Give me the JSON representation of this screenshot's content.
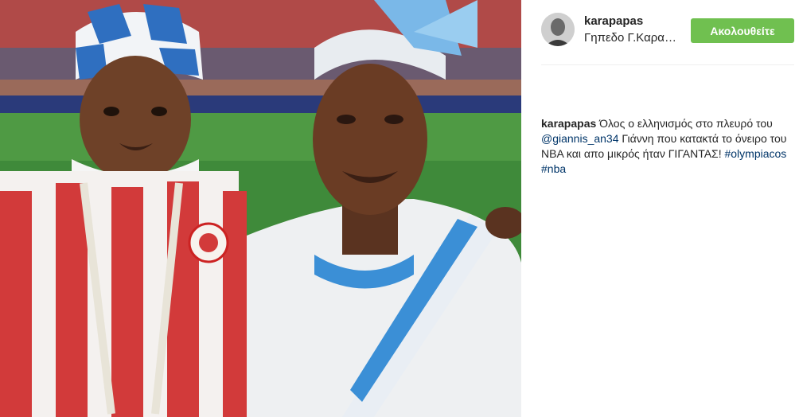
{
  "post": {
    "username": "karapapas",
    "location": "Γηπεδο Γ.Καραϊσκάκης",
    "follow_label": "Ακολουθείτε"
  },
  "caption": {
    "username": "karapapas",
    "text_1": " Όλος ο ελληνισμός στο πλευρό του ",
    "mention": "@giannis_an34",
    "text_2": " Γιάννη που κατακτά το όνειρο του NBA και απο μικρός ήταν ΓΙΓΑΝΤΑΣ! ",
    "hashtag_1": "#olympiacos",
    "space": " ",
    "hashtag_2": "#nba"
  },
  "colors": {
    "follow_button": "#70c050",
    "link": "#003569",
    "jersey_red": "#d23a3a",
    "greek_blue": "#3b8fd6"
  },
  "icons": {
    "avatar": "profile-photo"
  }
}
